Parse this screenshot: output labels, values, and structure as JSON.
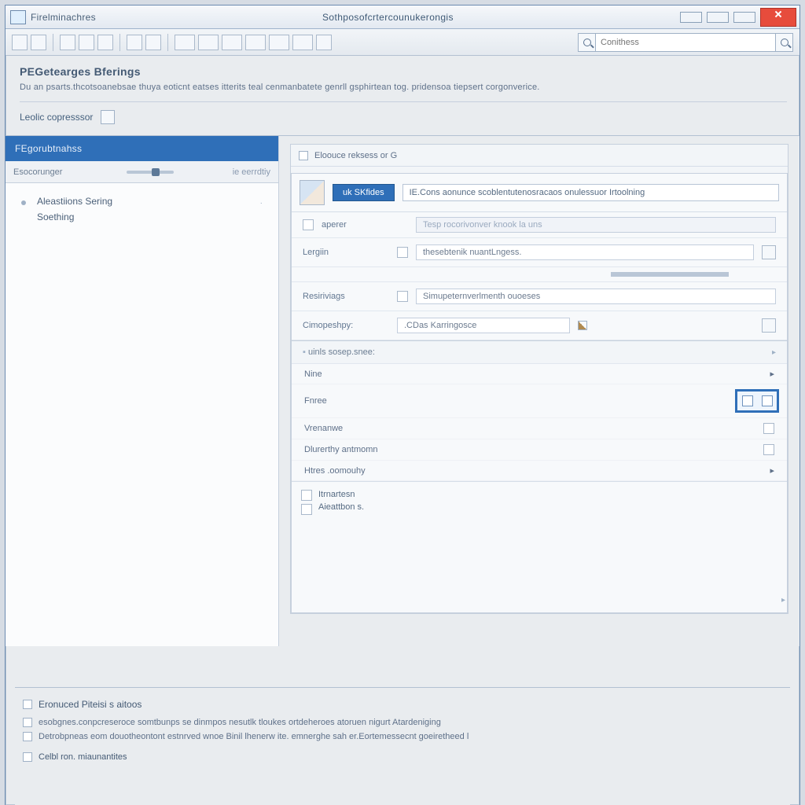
{
  "titlebar": {
    "app_name": "Firelminachres",
    "doc_title": "Sothposofcrtercounukerongis"
  },
  "search": {
    "placeholder": "Conithess"
  },
  "page": {
    "title": "PEGetearges Bferings",
    "subtitle": "Du an psarts.thcotsoanebsae thuya eoticnt eatses itterits teal cenmanbatete genrll gsphirtean tog. pridensoa tiepsert corgonverice.",
    "composer_label": "Leolic copresssor"
  },
  "sidebar": {
    "header": "FEgorubtnahss",
    "filter_left": "Esocorunger",
    "filter_right": "ie eerrdtiy",
    "items": [
      {
        "line1": "Aleastiions Sering",
        "line2": "Soething"
      }
    ]
  },
  "panel": {
    "head_label": "Eloouce reksess or G"
  },
  "card": {
    "chip": "uk SKfides",
    "title_value": "IE.Cons aonunce scoblentutenosracaos onulessuor Irtoolning",
    "rows": {
      "aperer": {
        "label": "aperer",
        "value": "Tesp rocorivonver knook la uns"
      },
      "length": {
        "label": "Lergiin",
        "value": "thesebtenik nuantLngess."
      },
      "restrict": {
        "label": "Resiriviags",
        "value": "Simupeternverlmenth ouoeses"
      },
      "compose": {
        "label": "Cimopeshpy:",
        "value": ".CDas Karringosce"
      }
    },
    "section_label": "uinls sosep.snee:",
    "props": {
      "nine": "Nine",
      "fnree": "Fnree",
      "venanwe": "Vrenanwe",
      "diverts": "Dlurerthy antmomn",
      "htes": "Htres .oomouhy"
    },
    "note1": "Itrnartesn",
    "note2": "Aieattbon s."
  },
  "footer": {
    "title": "Eronuced Piteisi s aitoos",
    "line1": "esobgnes.conpcreseroce somtbunps se dinmpos nesutlk tloukes ortdeheroes atoruen nigurt Atardeniging",
    "line2": "Detrobpneas eom douotheontont estnrved wnoe Binil lhenerw ite. emnerghe sah er.Eortemessecnt goeiretheed l",
    "link": "Celbl ron. miaunantites"
  }
}
